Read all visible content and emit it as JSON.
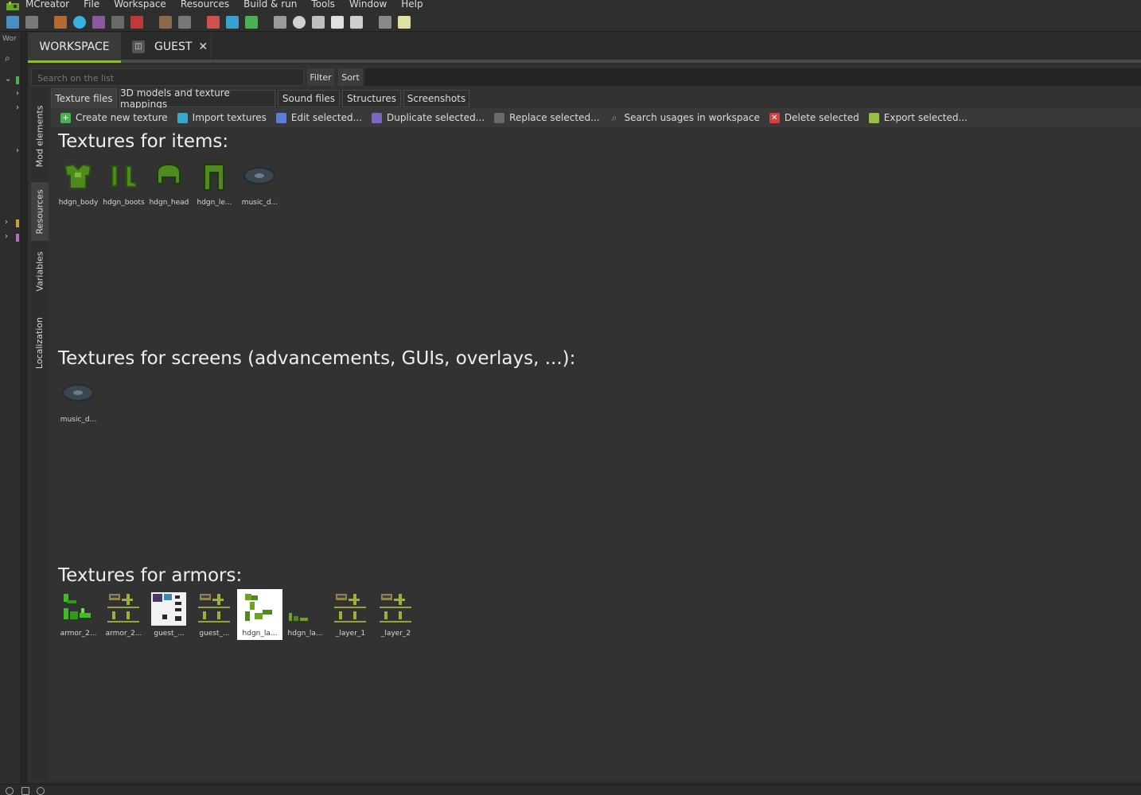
{
  "menubar": {
    "items": [
      "MCreator",
      "File",
      "Workspace",
      "Resources",
      "Build & run",
      "Tools",
      "Window",
      "Help"
    ]
  },
  "left_strip": {
    "label": "Wor"
  },
  "tabs": {
    "workspace": "WORKSPACE",
    "guest": "GUEST",
    "close": "✕"
  },
  "search": {
    "placeholder": "Search on the list",
    "filter": "Filter",
    "sort": "Sort"
  },
  "side_tabs": [
    "Mod elements",
    "Resources",
    "Variables",
    "Localization"
  ],
  "sub_tabs": [
    "Texture files",
    "3D models and texture mappings",
    "Sound files",
    "Structures",
    "Screenshots"
  ],
  "actions": [
    {
      "label": "Create new texture",
      "icon": "plus-icon",
      "color": "#4caf50"
    },
    {
      "label": "Import textures",
      "icon": "import-icon",
      "color": "#3aa8c8"
    },
    {
      "label": "Edit selected...",
      "icon": "edit-icon",
      "color": "#5b7fd6"
    },
    {
      "label": "Duplicate selected...",
      "icon": "duplicate-icon",
      "color": "#7e66c4"
    },
    {
      "label": "Replace selected...",
      "icon": "replace-icon",
      "color": "#6a6a6a"
    },
    {
      "label": "Search usages in workspace",
      "icon": "search-icon",
      "color": "#c89b48"
    },
    {
      "label": "Delete selected",
      "icon": "delete-icon",
      "color": "#d84040"
    },
    {
      "label": "Export selected...",
      "icon": "export-icon",
      "color": "#9bbe4a"
    }
  ],
  "sections": {
    "items": {
      "title": "Textures for items:",
      "tiles": [
        "hdgn_body",
        "hdgn_boots",
        "hdgn_head",
        "hdgn_le...",
        "music_d..."
      ]
    },
    "screens": {
      "title": "Textures for screens (advancements, GUIs, overlays, ...):",
      "tiles": [
        "music_d..."
      ]
    },
    "armors": {
      "title": "Textures for armors:",
      "tiles": [
        "armor_2...",
        "armor_2...",
        "guest_...",
        "guest_...",
        "hdgn_la...",
        "hdgn_la...",
        "_layer_1",
        "_layer_2"
      ]
    }
  },
  "colors": {
    "accent": "#8fbe2f",
    "background": "#323232",
    "armor_green": "#6fa21f"
  }
}
